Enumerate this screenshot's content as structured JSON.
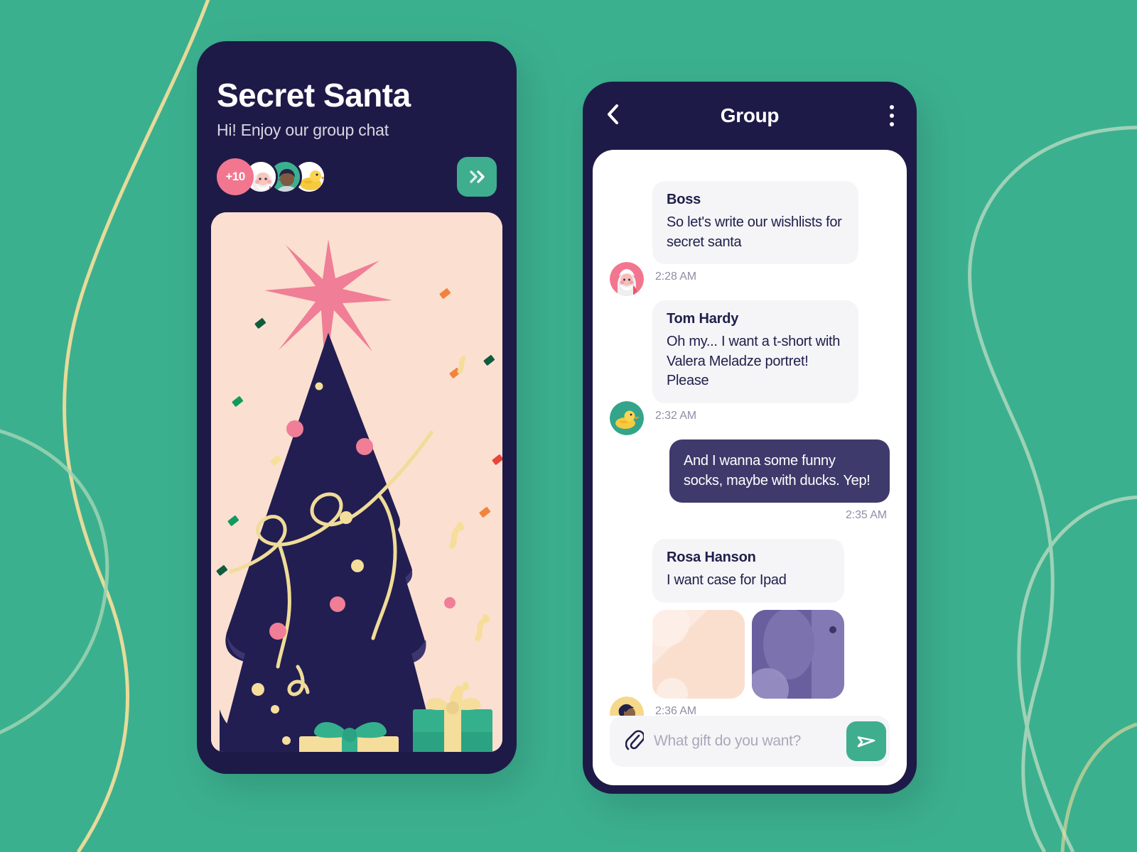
{
  "theme": {
    "background": "#3bb08f",
    "phone_dark": "#1e1a47",
    "accent_teal": "#3fae8e",
    "accent_pink": "#f2768f",
    "bubble_gray": "#f5f5f8",
    "bubble_out": "#3e3a6b",
    "illustration_bg": "#fbdfd0",
    "cream": "#f5e3a8"
  },
  "phone_left": {
    "title": "Secret Santa",
    "subtitle": "Hi! Enjoy our group chat",
    "avatar_overflow_label": "+10",
    "avatars": [
      {
        "name": "santa-avatar"
      },
      {
        "name": "person-avatar"
      },
      {
        "name": "duck-avatar"
      }
    ],
    "next_button_icon": "double-chevron-right-icon",
    "illustration": "christmas-tree-with-gifts"
  },
  "phone_right": {
    "header": {
      "back_icon": "chevron-left-icon",
      "title": "Group",
      "menu_icon": "kebab-menu-icon"
    },
    "messages": [
      {
        "direction": "in",
        "avatar": "santa-avatar",
        "sender": "Boss",
        "text": "So let's write our wishlists for secret santa",
        "time": "2:28 AM"
      },
      {
        "direction": "in",
        "avatar": "duck-avatar",
        "sender": "Tom Hardy",
        "text": "Oh my... I want a t-short with Valera Meladze portret! Please",
        "time": "2:32 AM"
      },
      {
        "direction": "out",
        "sender": "",
        "text": "And I wanna some funny socks, maybe with ducks. Yep!",
        "time": "2:35 AM"
      },
      {
        "direction": "in",
        "avatar": "woman-avatar",
        "sender": "Rosa Hanson",
        "text": "I want case for Ipad",
        "time": "2:36 AM",
        "attachments": [
          {
            "name": "ipad-case-peach-thumbnail"
          },
          {
            "name": "ipad-case-purple-thumbnail"
          }
        ]
      }
    ],
    "composer": {
      "attach_icon": "paperclip-icon",
      "placeholder": "What gift do you want?",
      "value": "",
      "send_icon": "send-plane-icon"
    }
  }
}
